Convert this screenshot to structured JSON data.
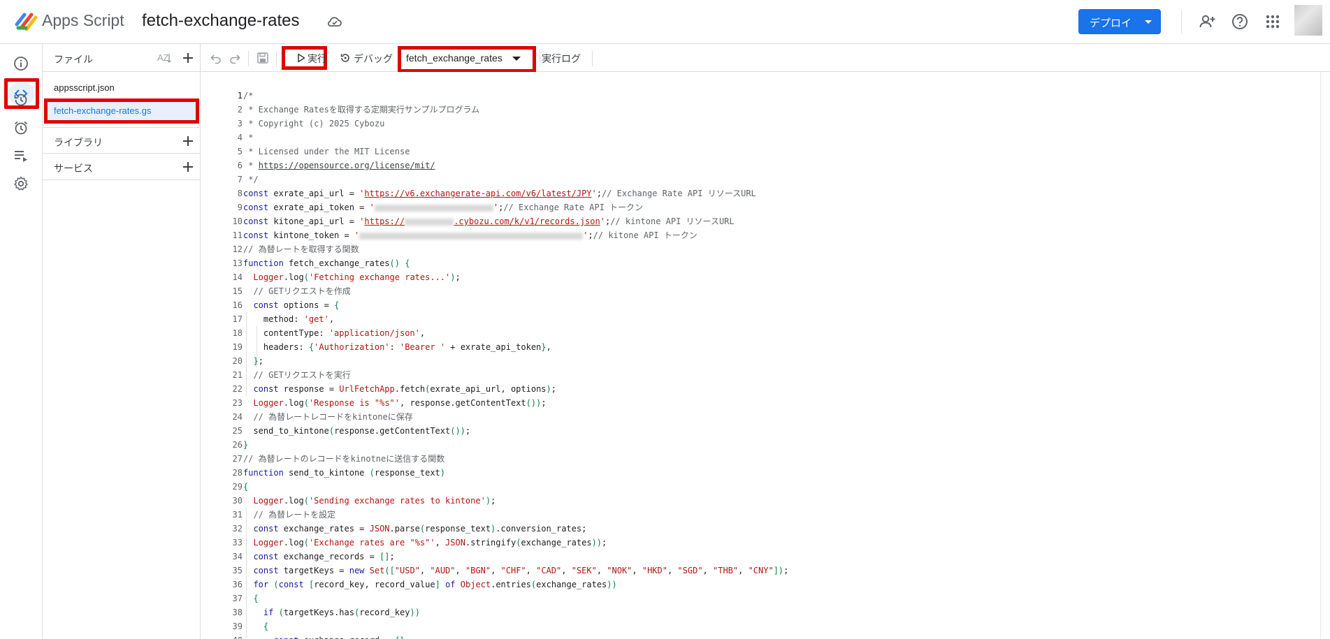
{
  "header": {
    "app_name": "Apps Script",
    "project_title": "fetch-exchange-rates",
    "deploy_label": "デプロイ",
    "icons": [
      "cloud-icon",
      "add-user-icon",
      "help-icon",
      "apps-grid-icon",
      "avatar"
    ]
  },
  "rail": {
    "items": [
      {
        "name": "overview",
        "icon": "info-icon"
      },
      {
        "name": "editor",
        "icon": "code-icon",
        "active": true
      },
      {
        "name": "triggers-history",
        "icon": "history-icon"
      },
      {
        "name": "triggers",
        "icon": "alarm-icon"
      },
      {
        "name": "executions",
        "icon": "executions-icon"
      },
      {
        "name": "settings",
        "icon": "gear-icon"
      }
    ]
  },
  "files_panel": {
    "title": "ファイル",
    "files": [
      "appsscript.json",
      "fetch-exchange-rates.gs"
    ],
    "selected_file": "fetch-exchange-rates.gs",
    "sections": [
      "ライブラリ",
      "サービス"
    ]
  },
  "toolbar": {
    "run_label": "実行",
    "debug_label": "デバッグ",
    "function_selected": "fetch_exchange_rates",
    "log_label": "実行ログ"
  },
  "editor": {
    "current_line": 1,
    "line_count_visible": 40
  },
  "colors": {
    "accent": "#1a73e8",
    "highlight": "#e00000",
    "selected_bg": "#e8f0fe"
  }
}
